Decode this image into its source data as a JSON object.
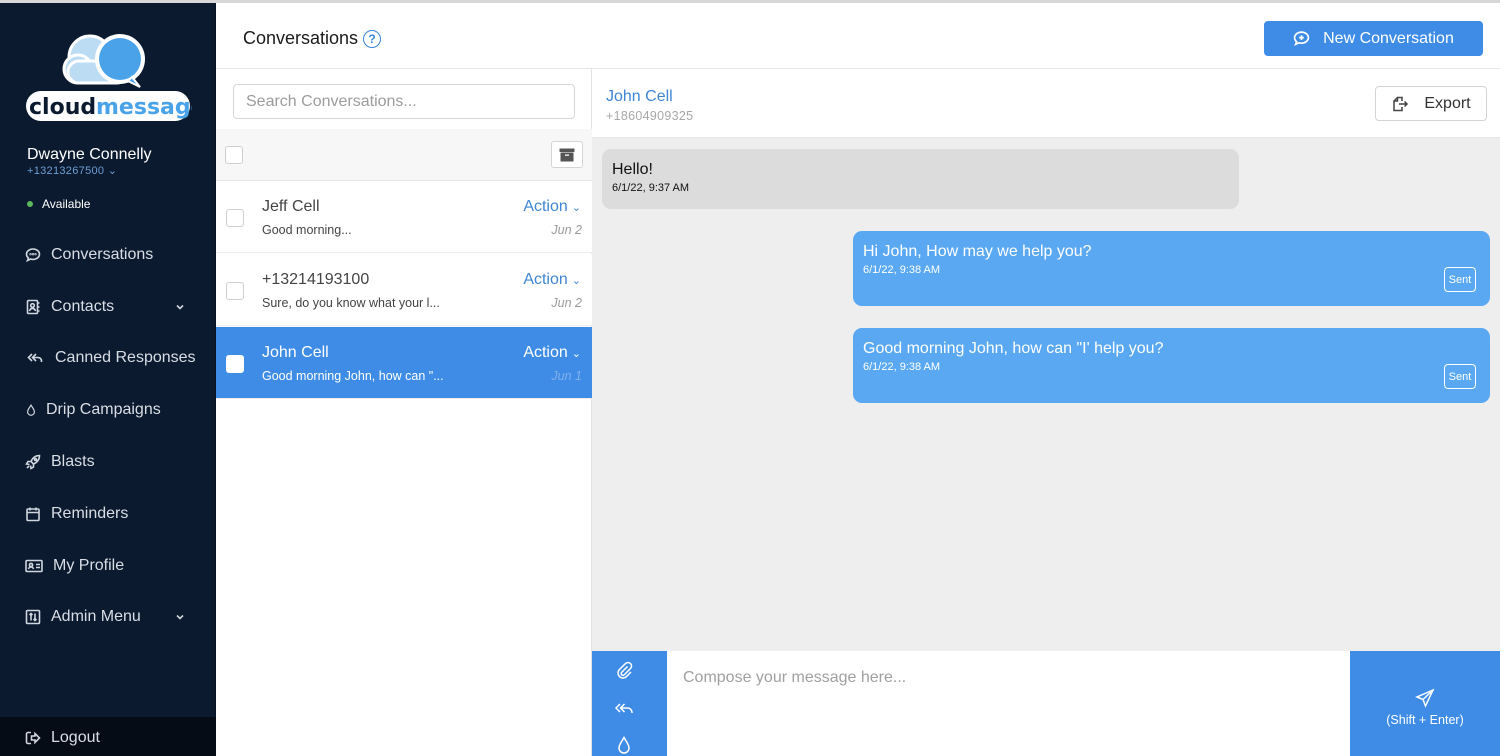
{
  "brand": {
    "name": "cloudmessage",
    "accent": "#3f8ce6",
    "sidebar_bg": "#0b1a2e"
  },
  "user": {
    "name": "Dwayne Connelly",
    "phone": "+13213267500",
    "status": "Available",
    "status_color": "#5cb85c"
  },
  "sidebar": {
    "items": [
      {
        "label": "Conversations",
        "icon": "chat-bubble-icon",
        "has_submenu": false
      },
      {
        "label": "Contacts",
        "icon": "contact-book-icon",
        "has_submenu": true
      },
      {
        "label": "Canned Responses",
        "icon": "reply-all-icon",
        "has_submenu": false
      },
      {
        "label": "Drip Campaigns",
        "icon": "droplet-icon",
        "has_submenu": false
      },
      {
        "label": "Blasts",
        "icon": "rocket-icon",
        "has_submenu": false
      },
      {
        "label": "Reminders",
        "icon": "calendar-icon",
        "has_submenu": false
      },
      {
        "label": "My Profile",
        "icon": "id-card-icon",
        "has_submenu": false
      },
      {
        "label": "Admin Menu",
        "icon": "admin-icon",
        "has_submenu": true
      }
    ],
    "logout": "Logout"
  },
  "header": {
    "title": "Conversations",
    "help": "?",
    "new_conversation": "New Conversation"
  },
  "list": {
    "search_placeholder": "Search Conversations...",
    "conversations": [
      {
        "name": "Jeff Cell",
        "preview": "Good morning...",
        "action": "Action",
        "date": "Jun 2",
        "active": false
      },
      {
        "name": "+13214193100",
        "preview": "Sure, do you know what your l...",
        "action": "Action",
        "date": "Jun 2",
        "active": false
      },
      {
        "name": "John Cell",
        "preview": "Good morning John, how can \"...",
        "action": "Action",
        "date": "Jun 1",
        "active": true
      }
    ]
  },
  "chat": {
    "contact_name": "John Cell",
    "contact_phone": "+18604909325",
    "export": "Export",
    "messages": [
      {
        "direction": "in",
        "text": "Hello!",
        "time": "6/1/22, 9:37 AM"
      },
      {
        "direction": "out",
        "text": "Hi John, How may we help you?",
        "time": "6/1/22, 9:38 AM",
        "status": "Sent"
      },
      {
        "direction": "out",
        "text": "Good morning John, how can \"I' help you?",
        "time": "6/1/22, 9:38 AM",
        "status": "Sent"
      }
    ],
    "compose_placeholder": "Compose your message here...",
    "send_hint": "(Shift + Enter)"
  }
}
